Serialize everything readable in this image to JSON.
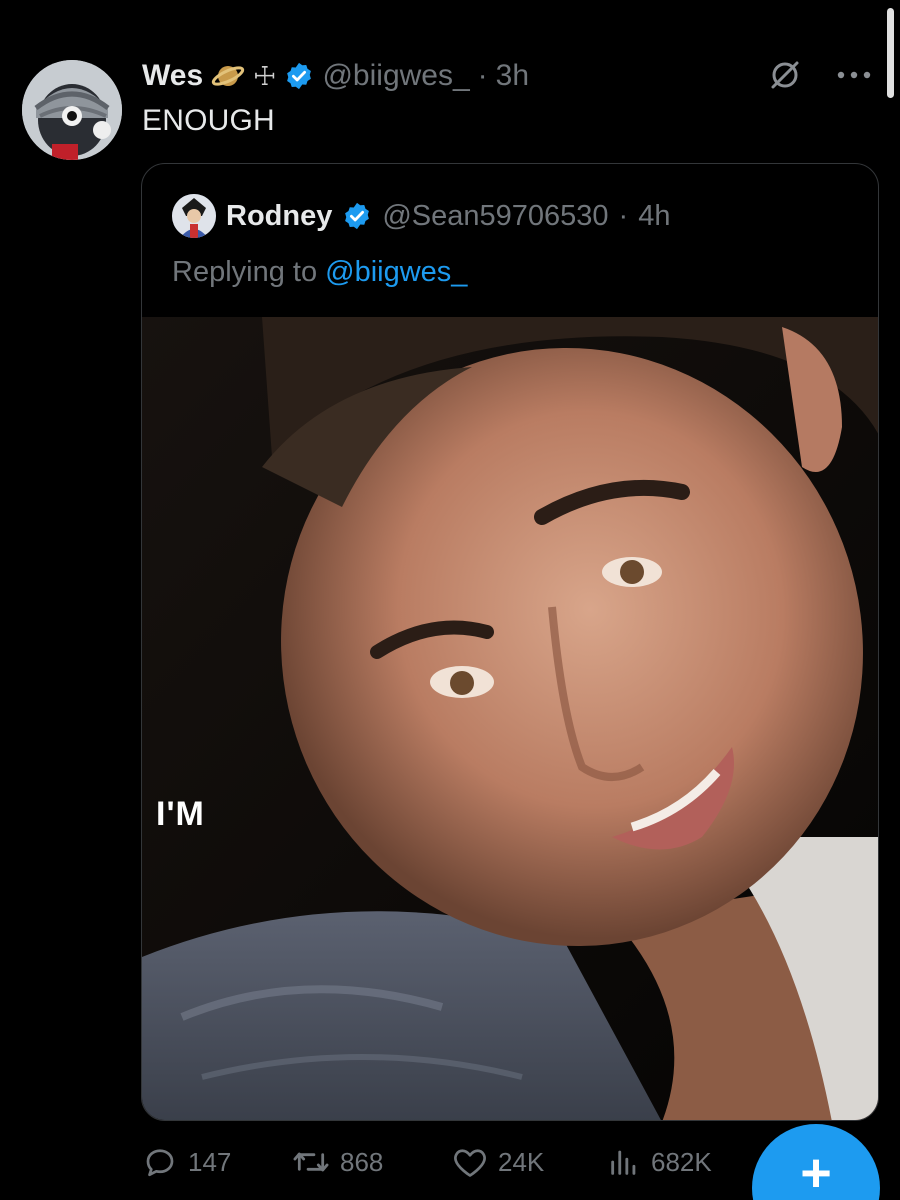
{
  "tweet": {
    "author_name": "Wes",
    "author_handle": "@biigwes_",
    "separator": "·",
    "time": "3h",
    "text": "ENOUGH",
    "icons": [
      "ringed-planet-emoji",
      "orthodox-cross-glyph",
      "verified-badge-icon",
      "grok-icon",
      "more-icon"
    ],
    "cross_glyph": "☩"
  },
  "quoted": {
    "author_name": "Rodney",
    "author_handle": "@Sean59706530",
    "separator": "·",
    "time": "4h",
    "reply_prefix": "Replying to ",
    "reply_target": "@biigwes_",
    "media_caption": "I'M"
  },
  "actions": {
    "replies": "147",
    "reposts": "868",
    "likes": "24K",
    "views": "682K"
  },
  "fab": {
    "label": "+"
  },
  "colors": {
    "background": "#000000",
    "text": "#e7e9ea",
    "secondary": "#71767b",
    "accent": "#1d9bf0",
    "border": "#333639"
  }
}
